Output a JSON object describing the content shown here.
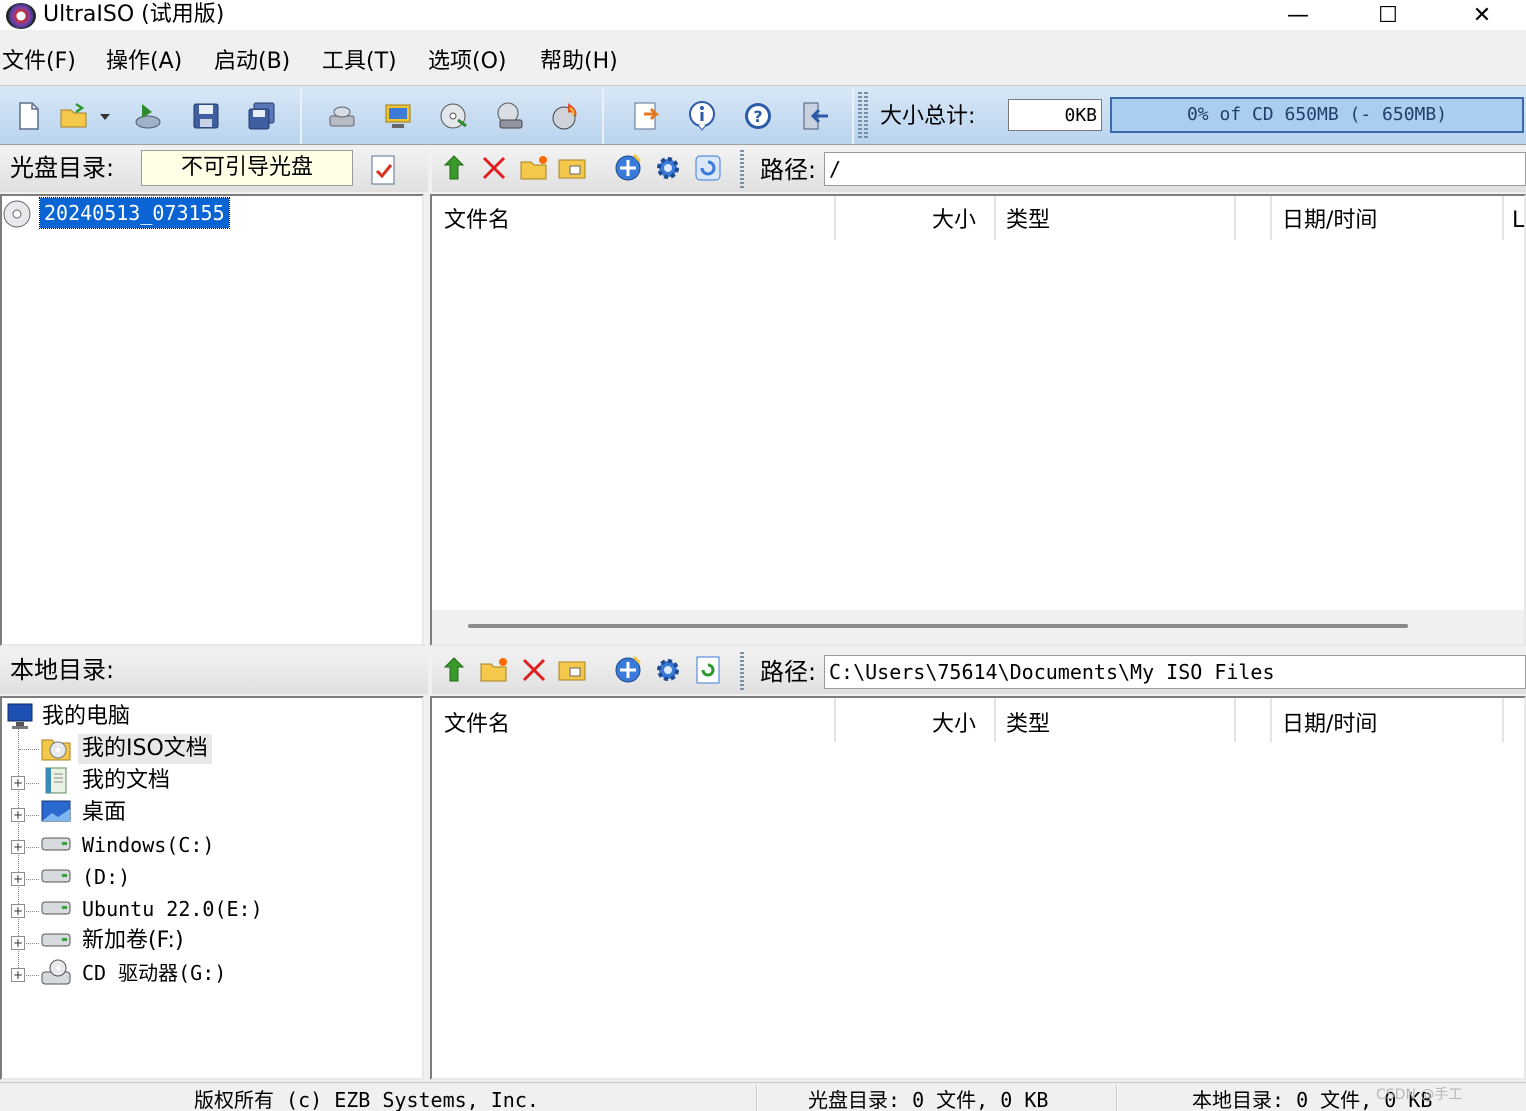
{
  "window": {
    "title": "UltraISO (试用版)",
    "controls": {
      "minimize": "—",
      "maximize": "☐",
      "close": "✕"
    }
  },
  "menu": [
    "文件(F)",
    "操作(A)",
    "启动(B)",
    "工具(T)",
    "选项(O)",
    "帮助(H)"
  ],
  "toolbar": {
    "size_label": "大小总计:",
    "size_value": "0KB",
    "cd_capacity": "0% of CD 650MB (- 650MB)",
    "buttons": [
      "new-file-icon",
      "open-icon",
      "open-dropdown-icon",
      "extract-icon",
      "save-icon",
      "save-as-icon",
      "burn-drive-icon",
      "mount-icon",
      "make-image-icon",
      "compress-icon",
      "burn-cd-icon",
      "options-icon",
      "info-icon",
      "help-icon",
      "exit-icon"
    ]
  },
  "iso_pane": {
    "label": "光盘目录:",
    "boot_status": "不可引导光盘",
    "root_node": "20240513_073155",
    "path_label": "路径:",
    "path_value": "/",
    "columns": [
      "文件名",
      "大小",
      "类型",
      "日期/时间",
      "L"
    ]
  },
  "local_pane": {
    "label": "本地目录:",
    "path_label": "路径:",
    "path_value": "C:\\Users\\75614\\Documents\\My ISO Files",
    "columns": [
      "文件名",
      "大小",
      "类型",
      "日期/时间"
    ],
    "tree": [
      {
        "label": "我的电脑",
        "icon": "computer-icon"
      },
      {
        "label": "我的ISO文档",
        "icon": "iso-folder-icon"
      },
      {
        "label": "我的文档",
        "icon": "documents-icon"
      },
      {
        "label": "桌面",
        "icon": "desktop-icon"
      },
      {
        "label": "Windows(C:)",
        "icon": "drive-icon"
      },
      {
        "label": "(D:)",
        "icon": "drive-icon"
      },
      {
        "label": "Ubuntu 22.0(E:)",
        "icon": "drive-icon"
      },
      {
        "label": "新加卷(F:)",
        "icon": "drive-icon"
      },
      {
        "label": "CD 驱动器(G:)",
        "icon": "cd-drive-icon"
      }
    ]
  },
  "status": {
    "copyright": "版权所有 (c) EZB Systems, Inc.",
    "iso_summary": "光盘目录: 0 文件, 0 KB",
    "local_summary": "本地目录: 0 文件, 0 KB",
    "watermark": "CSDN @手工"
  },
  "colors": {
    "toolbar_bg": "#c6dcf2",
    "cd_bar": "#a9cef0",
    "selection": "#0a64d4"
  }
}
